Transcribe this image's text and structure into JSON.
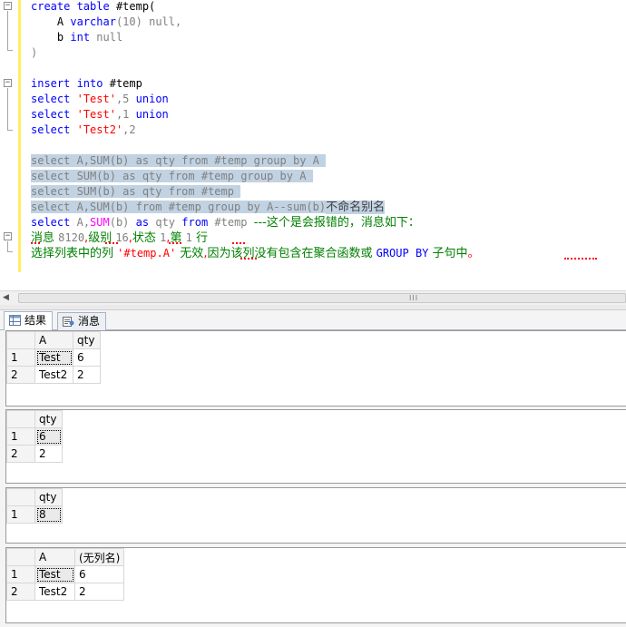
{
  "editor": {
    "line1": {
      "kw": "create table",
      "obj": "#temp("
    },
    "line2": {
      "col": "A",
      "type": "varchar",
      "args": "(10)",
      "null": "null,"
    },
    "line3": {
      "col": "b",
      "type": "int",
      "null": "null"
    },
    "line4": {
      "text": ")"
    },
    "line6": {
      "kw": "insert into",
      "obj": "#temp"
    },
    "line7": {
      "kw": "select",
      "str": "'Test'",
      "rest": ",5",
      "kw2": "union"
    },
    "line8": {
      "kw": "select",
      "str": "'Test'",
      "rest": ",1",
      "kw2": "union"
    },
    "line9": {
      "kw": "select",
      "str": "'Test2'",
      "rest": ",2"
    },
    "line11": {
      "text": "select A,SUM(b) as qty from #temp group by A "
    },
    "line12": {
      "text": "select SUM(b) as qty from #temp group by A "
    },
    "line13": {
      "text": "select SUM(b) as qty from #temp "
    },
    "line14": {
      "text": "select A,SUM(b) from #temp group by A--sum(b)",
      "cjk": "不命名别名"
    },
    "line15": {
      "kw": "select",
      "col": "A,",
      "fn": "SUM",
      "args": "(b)",
      "kw2": "as",
      "col2": "qty",
      "kw3": "from",
      "obj": "#temp",
      "comment": "---这个是会报错的，消息如下："
    },
    "line16": {
      "part1": "消息 ",
      "num1": "8120",
      "part2": "级别 ",
      "num2": "16",
      "part3": "状态 ",
      "num3": "1",
      "part4": "第 ",
      "num4": "1",
      "part5": " 行"
    },
    "line17": {
      "part1": "选择列表中的列 ",
      "str": "'#temp.A'",
      "part2": " 无效",
      "part3": "因为该列没有包含在聚合函数或 ",
      "kw": "GROUP BY",
      "part4": " 子句中",
      "part5": "。"
    }
  },
  "scrollbar": {
    "left_arrow": "◀",
    "grip": "III"
  },
  "tabs": [
    {
      "label": "结果",
      "icon": "grid-icon",
      "active": true
    },
    {
      "label": "消息",
      "icon": "message-icon",
      "active": false
    }
  ],
  "grids": [
    {
      "columns": [
        "A",
        "qty"
      ],
      "rows": [
        {
          "num": "1",
          "cells": [
            "Test",
            "6"
          ]
        },
        {
          "num": "2",
          "cells": [
            "Test2",
            "2"
          ]
        }
      ]
    },
    {
      "columns": [
        "qty"
      ],
      "rows": [
        {
          "num": "1",
          "cells": [
            "6"
          ]
        },
        {
          "num": "2",
          "cells": [
            "2"
          ]
        }
      ]
    },
    {
      "columns": [
        "qty"
      ],
      "rows": [
        {
          "num": "1",
          "cells": [
            "8"
          ]
        }
      ]
    },
    {
      "columns": [
        "A",
        "(无列名)"
      ],
      "rows": [
        {
          "num": "1",
          "cells": [
            "Test",
            "6"
          ]
        },
        {
          "num": "2",
          "cells": [
            "Test2",
            "2"
          ]
        }
      ]
    }
  ],
  "colors": {
    "selection": "#c1d2e2",
    "keyword": "#0000ff",
    "string": "#ff0000",
    "function": "#ff00ff",
    "comment": "#008000",
    "grayed": "#808080",
    "change_bar": "#ffee62"
  }
}
